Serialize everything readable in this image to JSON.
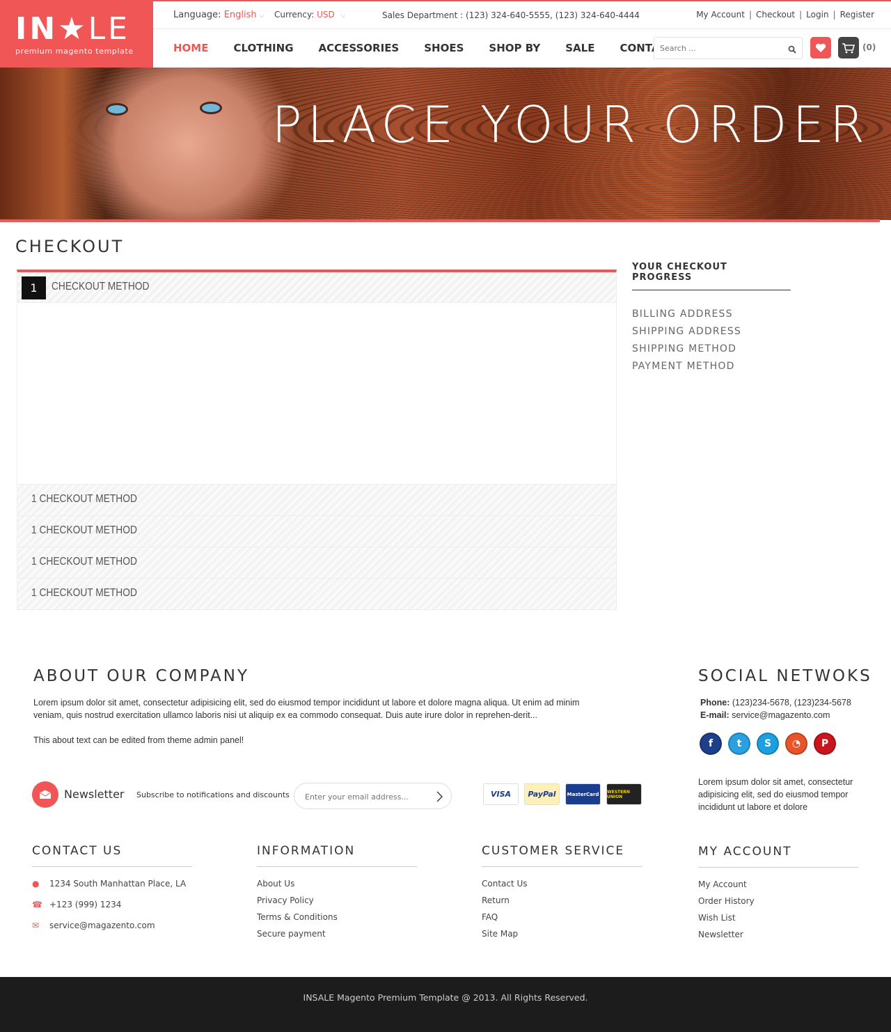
{
  "logo": {
    "name_part1": "IN",
    "name_star": "★",
    "name_part2": "LE",
    "tagline": "premium magento template"
  },
  "topbar": {
    "language_label": "Language:",
    "language_value": "English",
    "currency_label": "Currency:",
    "currency_value": "USD",
    "phone": "Sales Department : (123) 324-640-5555, (123) 324-640-4444",
    "links": [
      "My Account",
      "Checkout",
      "Login",
      "Register"
    ]
  },
  "nav": {
    "items": [
      "HOME",
      "CLOTHING",
      "ACCESSORIES",
      "SHOES",
      "SHOP BY",
      "SALE",
      "CONTACT"
    ],
    "active": "HOME"
  },
  "search": {
    "placeholder": "Search ..."
  },
  "cart": {
    "count": "(0)"
  },
  "banner": {
    "title": "PLACE YOUR ORDER"
  },
  "page": {
    "title": "CHECKOUT"
  },
  "checkout": {
    "active_step": {
      "number": "1",
      "label": "CHECKOUT METHOD"
    },
    "steps": [
      "1 CHECKOUT METHOD",
      "1 CHECKOUT METHOD",
      "1 CHECKOUT METHOD",
      "1 CHECKOUT METHOD"
    ]
  },
  "progress": {
    "title": "YOUR CHECKOUT PROGRESS",
    "items": [
      "BILLING ADDRESS",
      "SHIPPING ADDRESS",
      "SHIPPING METHOD",
      "PAYMENT METHOD"
    ]
  },
  "about": {
    "title": "ABOUT OUR COMPANY",
    "text1": "Lorem ipsum dolor sit amet, consectetur adipisicing elit, sed do eiusmod tempor incididunt ut labore et dolore magna aliqua. Ut enim ad minim veniam, quis nostrud exercitation ullamco laboris nisi ut aliquip ex ea commodo consequat. Duis aute irure dolor in reprehen-derit...",
    "text2": "This about text can be edited from theme admin panel!"
  },
  "social": {
    "title": "SOCIAL NETWOKS",
    "phone_label": "Phone:",
    "phone": "(123)234-5678, (123)234-5678",
    "email_label": "E-mail:",
    "email": "service@magazento.com",
    "icons": [
      "facebook-icon",
      "twitter-icon",
      "skype-icon",
      "rss-icon",
      "pinterest-icon"
    ],
    "text": "Lorem ipsum dolor sit amet, consectetur adipisicing elit, sed do eiusmod tempor incididunt ut labore et dolore"
  },
  "newsletter": {
    "title": "Newsletter",
    "subtitle": "Subscribe to notifications and discounts",
    "placeholder": "Enter your email address..."
  },
  "payments": [
    "VISA",
    "PayPal",
    "MasterCard",
    "WESTERN UNION"
  ],
  "footer": {
    "contact": {
      "title": "CONTACT US",
      "address": "1234 South Manhattan Place, LA",
      "phone": "+123 (999) 1234",
      "email": "service@magazento.com"
    },
    "information": {
      "title": "INFORMATION",
      "links": [
        "About Us",
        "Privacy Policy",
        "Terms & Conditions",
        "Secure payment"
      ]
    },
    "customer_service": {
      "title": "CUSTOMER SERVICE",
      "links": [
        "Contact Us",
        "Return",
        "FAQ",
        "Site Map"
      ]
    },
    "my_account": {
      "title": "MY ACCOUNT",
      "links": [
        "My Account",
        "Order History",
        "Wish List",
        "Newsletter"
      ]
    }
  },
  "copyright": "INSALE Magento Premium Template @ 2013. All Rights Reserved.",
  "colors": {
    "accent": "#f05656",
    "dark": "#1c1c1c"
  }
}
